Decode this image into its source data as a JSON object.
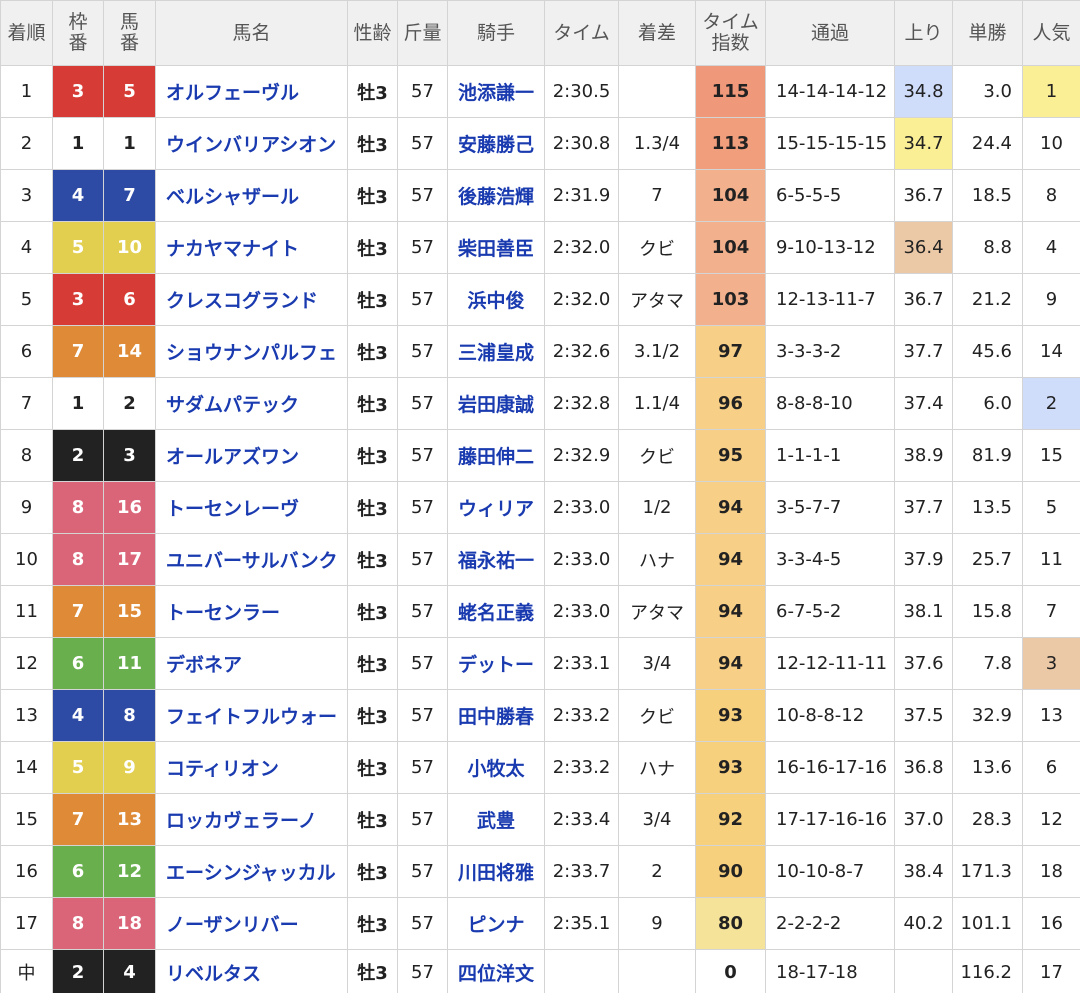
{
  "headers": [
    "着順",
    "枠番",
    "馬番",
    "馬名",
    "性齢",
    "斤量",
    "騎手",
    "タイム",
    "着差",
    "タイム指数",
    "通過",
    "上り",
    "単勝",
    "人気"
  ],
  "headers_multiline": {
    "1": [
      "枠",
      "番"
    ],
    "2": [
      "馬",
      "番"
    ],
    "9": [
      "タイム",
      "指数"
    ]
  },
  "waku_colors": {
    "1": "#ffffff",
    "2": "#222222",
    "3": "#d63c35",
    "4": "#2d4ba5",
    "5": "#e2cf4f",
    "6": "#6aaf4e",
    "7": "#de8a36",
    "8": "#db6578"
  },
  "waku_text_colors": {
    "1": "#222222"
  },
  "index_colors": {
    "115": "#f0987a",
    "113": "#f19e7d",
    "104": "#f3b08c",
    "103": "#f3b08c",
    "97": "#f7cf86",
    "96": "#f7cf86",
    "95": "#f7cf86",
    "94": "#f7cf86",
    "93": "#f7d07e",
    "92": "#f7d07e",
    "90": "#f7d07e",
    "80": "#f6e39a",
    "0": "#ffffff"
  },
  "highlight_colors": {
    "yellow": "#fbef96",
    "blue": "#cfdcfa",
    "tan": "#ecc9a6"
  },
  "rows": [
    {
      "rank": "1",
      "waku": "3",
      "uma": "5",
      "horse": "オルフェーヴル",
      "sexage": "牡3",
      "weight": "57",
      "jockey": "池添謙一",
      "time": "2:30.5",
      "margin": "",
      "index": "115",
      "passing": "14-14-14-12",
      "agari": "34.8",
      "agari_hl": "blue",
      "odds": "3.0",
      "pop": "1",
      "pop_hl": "yellow"
    },
    {
      "rank": "2",
      "waku": "1",
      "uma": "1",
      "horse": "ウインバリアシオン",
      "sexage": "牡3",
      "weight": "57",
      "jockey": "安藤勝己",
      "time": "2:30.8",
      "margin": "1.3/4",
      "index": "113",
      "passing": "15-15-15-15",
      "agari": "34.7",
      "agari_hl": "yellow",
      "odds": "24.4",
      "pop": "10",
      "pop_hl": ""
    },
    {
      "rank": "3",
      "waku": "4",
      "uma": "7",
      "horse": "ベルシャザール",
      "sexage": "牡3",
      "weight": "57",
      "jockey": "後藤浩輝",
      "time": "2:31.9",
      "margin": "7",
      "index": "104",
      "passing": "6-5-5-5",
      "agari": "36.7",
      "agari_hl": "",
      "odds": "18.5",
      "pop": "8",
      "pop_hl": ""
    },
    {
      "rank": "4",
      "waku": "5",
      "uma": "10",
      "horse": "ナカヤマナイト",
      "sexage": "牡3",
      "weight": "57",
      "jockey": "柴田善臣",
      "time": "2:32.0",
      "margin": "クビ",
      "index": "104",
      "passing": "9-10-13-12",
      "agari": "36.4",
      "agari_hl": "tan",
      "odds": "8.8",
      "pop": "4",
      "pop_hl": ""
    },
    {
      "rank": "5",
      "waku": "3",
      "uma": "6",
      "horse": "クレスコグランド",
      "sexage": "牡3",
      "weight": "57",
      "jockey": "浜中俊",
      "time": "2:32.0",
      "margin": "アタマ",
      "index": "103",
      "passing": "12-13-11-7",
      "agari": "36.7",
      "agari_hl": "",
      "odds": "21.2",
      "pop": "9",
      "pop_hl": ""
    },
    {
      "rank": "6",
      "waku": "7",
      "uma": "14",
      "horse": "ショウナンパルフェ",
      "sexage": "牡3",
      "weight": "57",
      "jockey": "三浦皇成",
      "time": "2:32.6",
      "margin": "3.1/2",
      "index": "97",
      "passing": "3-3-3-2",
      "agari": "37.7",
      "agari_hl": "",
      "odds": "45.6",
      "pop": "14",
      "pop_hl": ""
    },
    {
      "rank": "7",
      "waku": "1",
      "uma": "2",
      "horse": "サダムパテック",
      "sexage": "牡3",
      "weight": "57",
      "jockey": "岩田康誠",
      "time": "2:32.8",
      "margin": "1.1/4",
      "index": "96",
      "passing": "8-8-8-10",
      "agari": "37.4",
      "agari_hl": "",
      "odds": "6.0",
      "pop": "2",
      "pop_hl": "blue"
    },
    {
      "rank": "8",
      "waku": "2",
      "uma": "3",
      "horse": "オールアズワン",
      "sexage": "牡3",
      "weight": "57",
      "jockey": "藤田伸二",
      "time": "2:32.9",
      "margin": "クビ",
      "index": "95",
      "passing": "1-1-1-1",
      "agari": "38.9",
      "agari_hl": "",
      "odds": "81.9",
      "pop": "15",
      "pop_hl": ""
    },
    {
      "rank": "9",
      "waku": "8",
      "uma": "16",
      "horse": "トーセンレーヴ",
      "sexage": "牡3",
      "weight": "57",
      "jockey": "ウィリア",
      "time": "2:33.0",
      "margin": "1/2",
      "index": "94",
      "passing": "3-5-7-7",
      "agari": "37.7",
      "agari_hl": "",
      "odds": "13.5",
      "pop": "5",
      "pop_hl": ""
    },
    {
      "rank": "10",
      "waku": "8",
      "uma": "17",
      "horse": "ユニバーサルバンク",
      "sexage": "牡3",
      "weight": "57",
      "jockey": "福永祐一",
      "time": "2:33.0",
      "margin": "ハナ",
      "index": "94",
      "passing": "3-3-4-5",
      "agari": "37.9",
      "agari_hl": "",
      "odds": "25.7",
      "pop": "11",
      "pop_hl": ""
    },
    {
      "rank": "11",
      "waku": "7",
      "uma": "15",
      "horse": "トーセンラー",
      "sexage": "牡3",
      "weight": "57",
      "jockey": "蛯名正義",
      "time": "2:33.0",
      "margin": "アタマ",
      "index": "94",
      "passing": "6-7-5-2",
      "agari": "38.1",
      "agari_hl": "",
      "odds": "15.8",
      "pop": "7",
      "pop_hl": ""
    },
    {
      "rank": "12",
      "waku": "6",
      "uma": "11",
      "horse": "デボネア",
      "sexage": "牡3",
      "weight": "57",
      "jockey": "デットー",
      "time": "2:33.1",
      "margin": "3/4",
      "index": "94",
      "passing": "12-12-11-11",
      "agari": "37.6",
      "agari_hl": "",
      "odds": "7.8",
      "pop": "3",
      "pop_hl": "tan"
    },
    {
      "rank": "13",
      "waku": "4",
      "uma": "8",
      "horse": "フェイトフルウォー",
      "sexage": "牡3",
      "weight": "57",
      "jockey": "田中勝春",
      "time": "2:33.2",
      "margin": "クビ",
      "index": "93",
      "passing": "10-8-8-12",
      "agari": "37.5",
      "agari_hl": "",
      "odds": "32.9",
      "pop": "13",
      "pop_hl": ""
    },
    {
      "rank": "14",
      "waku": "5",
      "uma": "9",
      "horse": "コティリオン",
      "sexage": "牡3",
      "weight": "57",
      "jockey": "小牧太",
      "time": "2:33.2",
      "margin": "ハナ",
      "index": "93",
      "passing": "16-16-17-16",
      "agari": "36.8",
      "agari_hl": "",
      "odds": "13.6",
      "pop": "6",
      "pop_hl": ""
    },
    {
      "rank": "15",
      "waku": "7",
      "uma": "13",
      "horse": "ロッカヴェラーノ",
      "sexage": "牡3",
      "weight": "57",
      "jockey": "武豊",
      "time": "2:33.4",
      "margin": "3/4",
      "index": "92",
      "passing": "17-17-16-16",
      "agari": "37.0",
      "agari_hl": "",
      "odds": "28.3",
      "pop": "12",
      "pop_hl": ""
    },
    {
      "rank": "16",
      "waku": "6",
      "uma": "12",
      "horse": "エーシンジャッカル",
      "sexage": "牡3",
      "weight": "57",
      "jockey": "川田将雅",
      "time": "2:33.7",
      "margin": "2",
      "index": "90",
      "passing": "10-10-8-7",
      "agari": "38.4",
      "agari_hl": "",
      "odds": "171.3",
      "pop": "18",
      "pop_hl": ""
    },
    {
      "rank": "17",
      "waku": "8",
      "uma": "18",
      "horse": "ノーザンリバー",
      "sexage": "牡3",
      "weight": "57",
      "jockey": "ピンナ",
      "time": "2:35.1",
      "margin": "9",
      "index": "80",
      "passing": "2-2-2-2",
      "agari": "40.2",
      "agari_hl": "",
      "odds": "101.1",
      "pop": "16",
      "pop_hl": ""
    },
    {
      "rank": "中",
      "waku": "2",
      "uma": "4",
      "horse": "リベルタス",
      "sexage": "牡3",
      "weight": "57",
      "jockey": "四位洋文",
      "time": "",
      "margin": "",
      "index": "0",
      "passing": "18-17-18",
      "agari": "",
      "agari_hl": "",
      "odds": "116.2",
      "pop": "17",
      "pop_hl": ""
    }
  ]
}
